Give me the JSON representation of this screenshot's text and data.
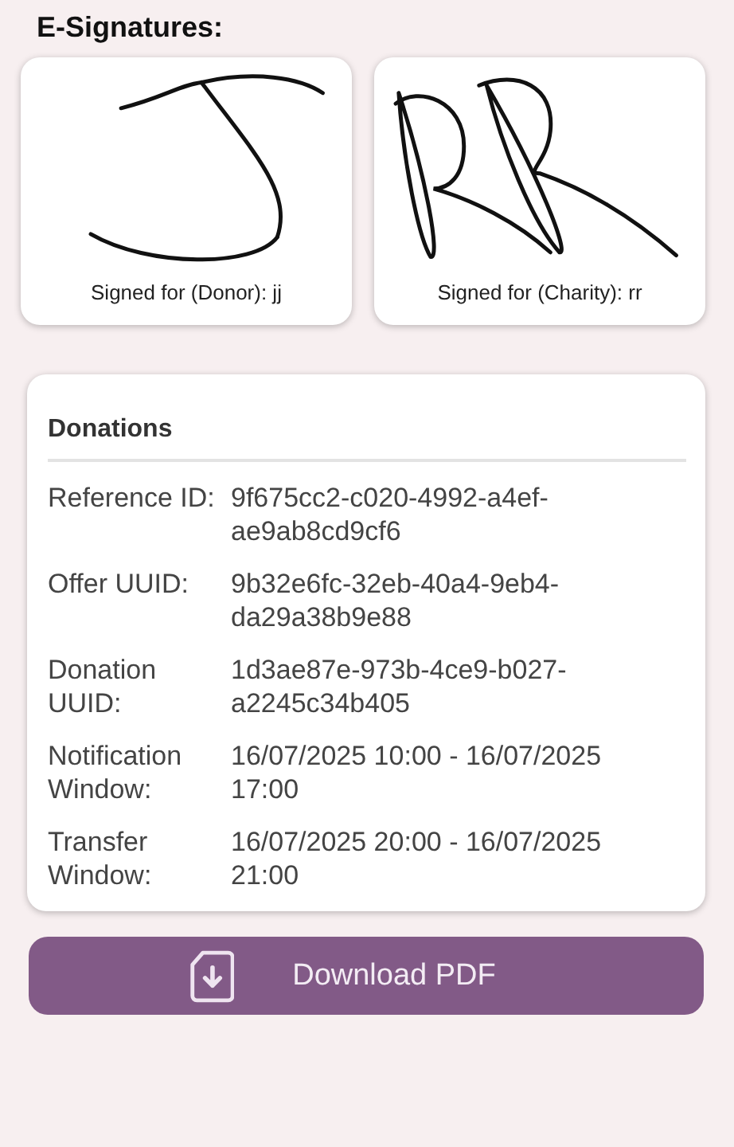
{
  "heading": "E-Signatures:",
  "signatures": [
    {
      "kind": "donor",
      "caption": "Signed for (Donor): jj"
    },
    {
      "kind": "charity",
      "caption": "Signed for (Charity): rr"
    }
  ],
  "donations": {
    "title": "Donations",
    "fields": [
      {
        "label": "Reference ID:",
        "value": "9f675cc2-c020-4992-a4ef-ae9ab8cd9cf6"
      },
      {
        "label": "Offer UUID:",
        "value": "9b32e6fc-32eb-40a4-9eb4-da29a38b9e88"
      },
      {
        "label": "Donation UUID:",
        "value": "1d3ae87e-973b-4ce9-b027-a2245c34b405"
      },
      {
        "label": "Notification Window:",
        "value": "16/07/2025 10:00 - 16/07/2025 17:00"
      },
      {
        "label": "Transfer Window:",
        "value": "16/07/2025 20:00 - 16/07/2025 21:00"
      }
    ]
  },
  "download_button": {
    "label": "Download PDF"
  }
}
